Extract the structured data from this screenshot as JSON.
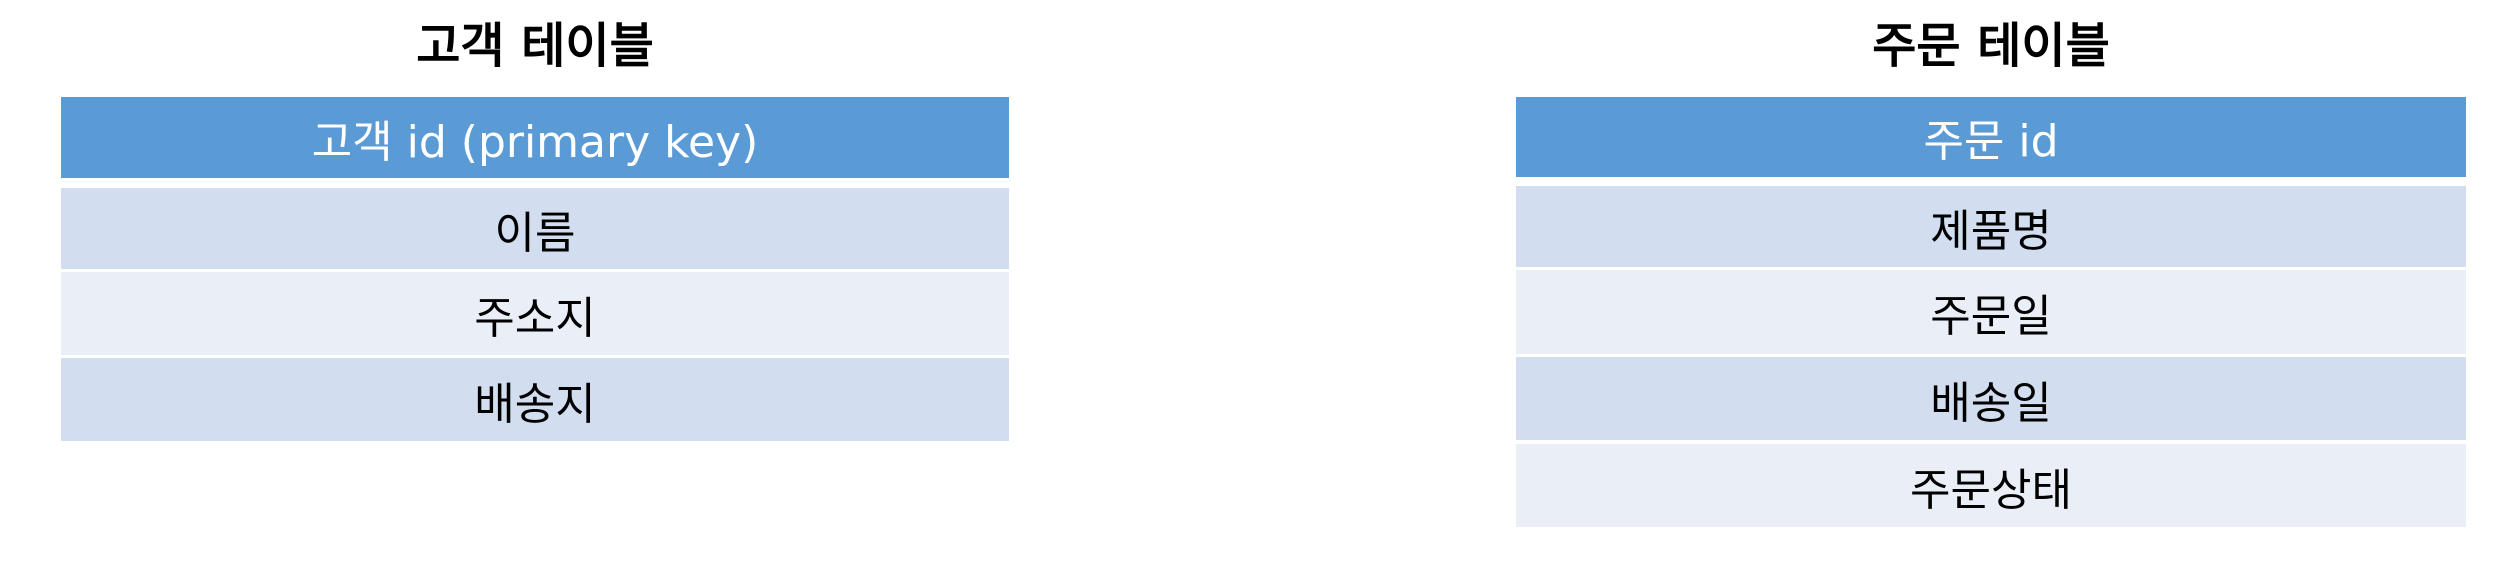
{
  "customer_table": {
    "title": "고객 테이블",
    "header": "고객 id (primary key)",
    "fields": [
      "이름",
      "주소지",
      "배송지"
    ]
  },
  "order_table": {
    "title": "주문 테이블",
    "header": "주문 id",
    "fields": [
      "제품명",
      "주문일",
      "배송일",
      "주문상태"
    ]
  },
  "colors": {
    "header": "#5b9bd5",
    "row_dark": "#d2deef",
    "row_light": "#e9eef7"
  }
}
